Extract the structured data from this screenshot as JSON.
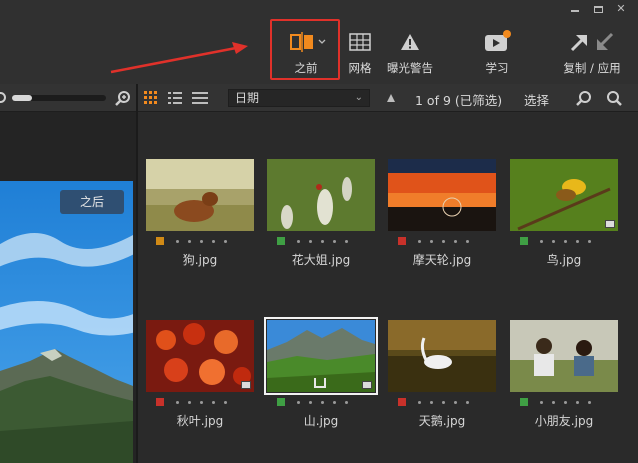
{
  "toolbar": {
    "tools": [
      {
        "id": "before",
        "label": "之前",
        "icon": "before-after-icon"
      },
      {
        "id": "grid",
        "label": "网格",
        "icon": "grid-icon"
      },
      {
        "id": "warning",
        "label": "曝光警告",
        "icon": "warning-icon"
      },
      {
        "id": "learn",
        "label": "学习",
        "icon": "play-icon"
      },
      {
        "id": "copy",
        "label": "复制 / 应用",
        "icon": "copy-apply-icon"
      }
    ],
    "accent_color": "#f28a1e",
    "highlight_color": "#e0312a"
  },
  "preview": {
    "after_label": "之后"
  },
  "grid_toolbar": {
    "sort_value": "日期",
    "counter": "1 of 9  (已筛选)",
    "select_label": "选择"
  },
  "thumbnails": [
    {
      "name": "狗.jpg",
      "label_color": "#d18a16"
    },
    {
      "name": "花大姐.jpg",
      "label_color": "#3f9f44"
    },
    {
      "name": "摩天轮.jpg",
      "label_color": "#c8312a"
    },
    {
      "name": "鸟.jpg",
      "label_color": "#3f9f44"
    },
    {
      "name": "秋叶.jpg",
      "label_color": "#c8312a"
    },
    {
      "name": "山.jpg",
      "label_color": "#3f9f44"
    },
    {
      "name": "天鹅.jpg",
      "label_color": "#c8312a"
    },
    {
      "name": "小朋友.jpg",
      "label_color": "#3f9f44"
    }
  ]
}
